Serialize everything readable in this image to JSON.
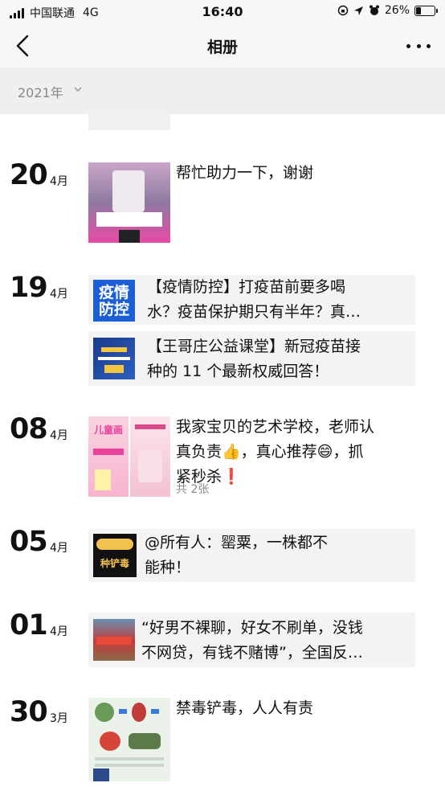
{
  "status_bar": {
    "carrier": "中国联通",
    "network": "4G",
    "time": "16:40",
    "battery": "26%"
  },
  "nav": {
    "title": "相册"
  },
  "year_filter": "2021年",
  "entries": [
    {
      "day": "20",
      "month": "4月",
      "text": "帮忙助力一下，谢谢"
    },
    {
      "day": "19",
      "month": "4月",
      "items": [
        {
          "text_l1": "【疫情防控】打疫苗前要多喝",
          "text_l2": "水？疫苗保护期只有半年？真…",
          "thumb_label_1": "疫情",
          "thumb_label_2": "防控"
        },
        {
          "text_l1": "【王哥庄公益课堂】新冠疫苗接",
          "text_l2": "种的 11 个最新权威回答！"
        }
      ]
    },
    {
      "day": "08",
      "month": "4月",
      "text_l1": "我家宝贝的艺术学校，老师认",
      "text_l2": "真负责👍，真心推荐😄，抓",
      "text_l3": "紧秒杀❗",
      "count": "共 2张",
      "thumb_label": "儿童画"
    },
    {
      "day": "05",
      "month": "4月",
      "text_l1": "@所有人：罂粟，一株都不",
      "text_l2": "能种！",
      "thumb_label": "种铲毒"
    },
    {
      "day": "01",
      "month": "4月",
      "text_l1": "“好男不裸聊，好女不刷单，没钱",
      "text_l2": "不网贷，有钱不赌博”，全国反…"
    },
    {
      "day": "30",
      "month": "3月",
      "text": "禁毒铲毒，人人有责"
    }
  ]
}
